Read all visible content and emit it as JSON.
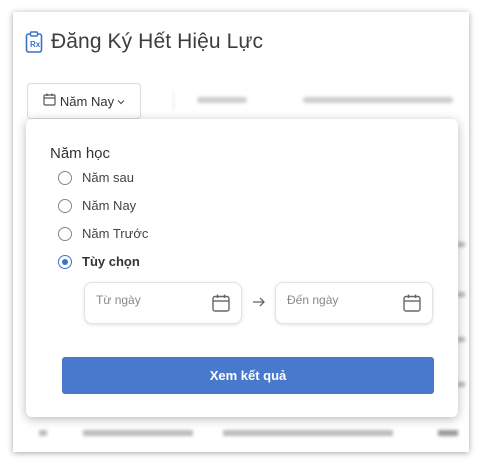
{
  "page": {
    "title": "Đăng Ký Hết Hiệu Lực"
  },
  "toolbar": {
    "year_filter_label": "Năm Nay"
  },
  "popup": {
    "section_title": "Năm học",
    "options": [
      {
        "label": "Năm sau",
        "checked": false
      },
      {
        "label": "Năm Nay",
        "checked": false
      },
      {
        "label": "Năm Trước",
        "checked": false
      },
      {
        "label": "Tùy chọn",
        "checked": true
      }
    ],
    "from_placeholder": "Từ ngày",
    "to_placeholder": "Đến ngày",
    "submit_label": "Xem kết quả"
  },
  "colors": {
    "accent": "#4879cc",
    "radio_checked": "#3b73c7"
  },
  "icons": {
    "title_icon": "prescription-clipboard-icon",
    "filter_icon": "calendar-icon",
    "filter_caret": "chevron-down-icon",
    "date_icon": "calendar-icon",
    "arrow": "arrow-right-icon"
  }
}
